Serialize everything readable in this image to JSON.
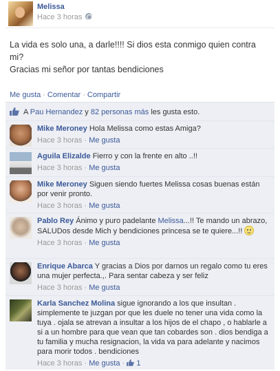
{
  "post": {
    "author": "Melissa",
    "time": "Hace 3 horas",
    "text_line1": "La vida es solo una, a darle!!!! Si dios esta conmigo quien contra mi?",
    "text_line2": "Gracias mi señor por tantas bendiciones"
  },
  "actions": {
    "like": "Me gusta",
    "comment": "Comentar",
    "share": "Compartir",
    "separator": "·"
  },
  "likes": {
    "prefix": "A ",
    "person": "Pau Hernandez",
    "middle": " y ",
    "others": "82 personas más",
    "suffix": " les gusta esto."
  },
  "comments": [
    {
      "name": "Mike Meroney",
      "text": "Hola Melissa como estas Amiga?",
      "time": "Hace 3 horas",
      "like": "Me gusta"
    },
    {
      "name": "Aguila Elizalde",
      "text": "Fierro y con la frente en alto ..!!",
      "time": "Hace 3 horas",
      "like": "Me gusta"
    },
    {
      "name": "Mike Meroney",
      "text": "Siguen siendo fuertes Melissa cosas buenas están por venir pronto.",
      "time": "Hace 3 horas",
      "like": "Me gusta"
    },
    {
      "name": "Pablo Rey",
      "text_before": "Ánimo y puro padelante ",
      "mention": "Melissa",
      "text_after": "...!! Te mando un abrazo, SALUDos desde Mich y bendiciones princesa se te quiere...!! ",
      "time": "Hace 3 horas",
      "like": "Me gusta"
    },
    {
      "name": "Enrique Abarca",
      "text": "Y gracias a Dios por darnos un regalo como tu eres una mujer perfecta.,. Para sentar cabeza y ser feliz",
      "time": "Hace 3 horas",
      "like": "Me gusta"
    },
    {
      "name": "Karla Sanchez Molina",
      "text": "sigue ignorando a los que insultan . simplemente te juzgan por que les duele no tener una vida como la tuya . ojala se atrevan a insultar a los hijos de el chapo , o hablarle a si a un hombre para que vean que tan cobardes son . dios bendiga a tu familia y mucha resignacion, la vida va para adelante y nacimos para morir todos . bendiciones",
      "time": "Hace 3 horas",
      "like": "Me gusta",
      "like_count": "1"
    }
  ]
}
